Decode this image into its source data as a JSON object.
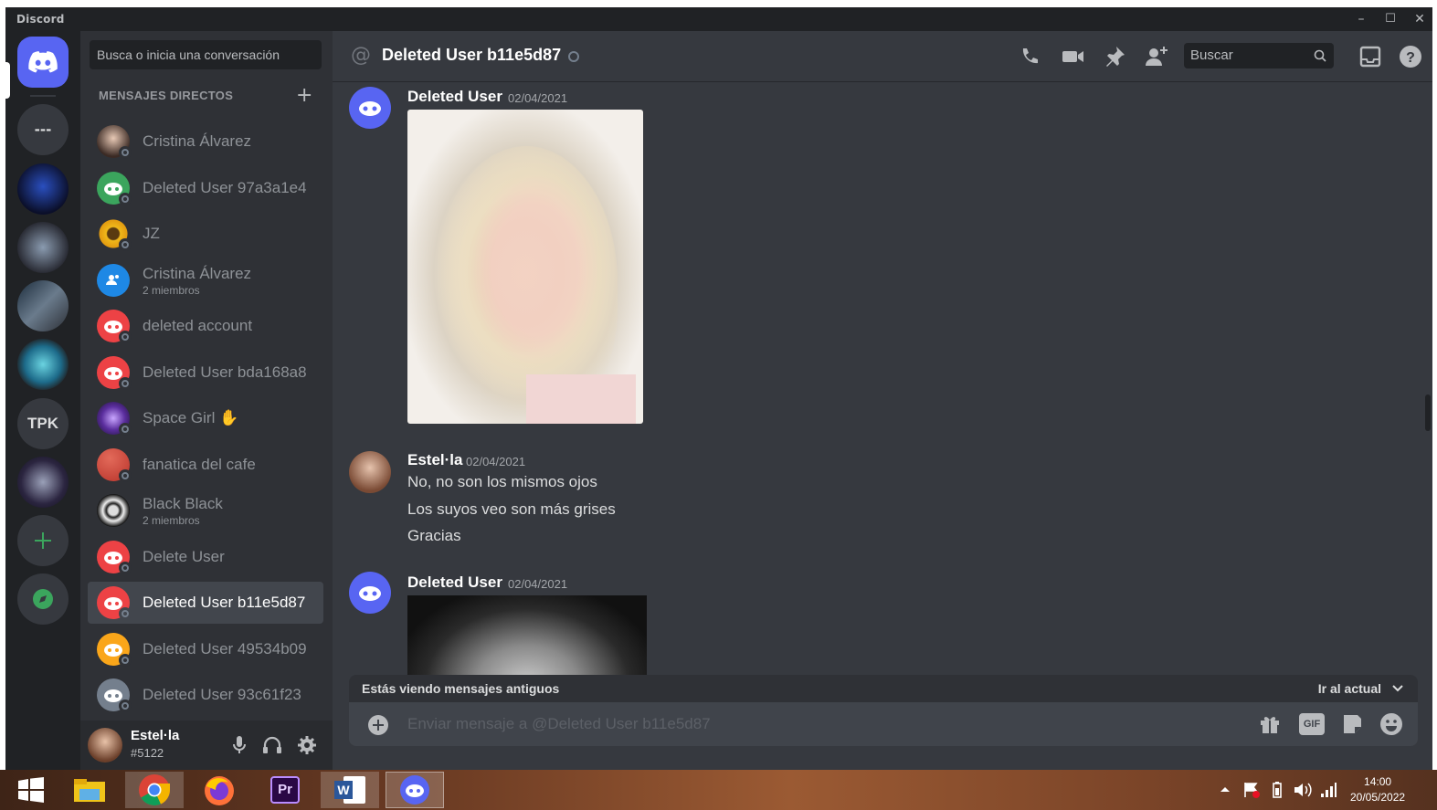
{
  "window": {
    "app_name": "Discord",
    "minimize": "–",
    "maximize": "☐",
    "close": "✕"
  },
  "colors": {
    "blurple": "#5865f2",
    "bg_chat": "#36393f",
    "bg_sidebar": "#2f3136",
    "bg_rail": "#202225",
    "green": "#3ba55d",
    "red": "#ed4245",
    "yellow": "#faa61a"
  },
  "servers": {
    "home_icon": "discord-logo-icon",
    "items": [
      "---",
      "TPK"
    ],
    "add_icon": "plus-icon",
    "explore_icon": "compass-icon"
  },
  "dms": {
    "search_placeholder": "Busca o inicia una conversación",
    "header": "MENSAJES DIRECTOS",
    "add_icon": "+",
    "items": [
      {
        "name": "Cristina Álvarez",
        "sub": ""
      },
      {
        "name": "Deleted User 97a3a1e4",
        "sub": ""
      },
      {
        "name": "JZ",
        "sub": ""
      },
      {
        "name": "Cristina Álvarez",
        "sub": "2 miembros"
      },
      {
        "name": "deleted account",
        "sub": ""
      },
      {
        "name": "Deleted User bda168a8",
        "sub": ""
      },
      {
        "name": "Space Girl",
        "sub": ""
      },
      {
        "name": "fanatica del cafe",
        "sub": ""
      },
      {
        "name": "Black Black",
        "sub": "2 miembros"
      },
      {
        "name": "Delete User",
        "sub": ""
      },
      {
        "name": "Deleted User b11e5d87",
        "sub": ""
      },
      {
        "name": "Deleted User 49534b09",
        "sub": ""
      },
      {
        "name": "Deleted User 93c61f23",
        "sub": ""
      }
    ],
    "selected_index": 10
  },
  "user": {
    "name": "Estel·la",
    "tag": "#5122"
  },
  "chat": {
    "title": "Deleted User b11e5d87",
    "search_placeholder": "Buscar",
    "messages": [
      {
        "author": "Deleted User",
        "time": "02/04/2021"
      },
      {
        "author": "Estel·la",
        "time": "02/04/2021",
        "lines": [
          "No, no son los mismos ojos",
          "Los suyos veo son más grises",
          "Gracias"
        ]
      },
      {
        "author": "Deleted User",
        "time": "02/04/2021"
      }
    ],
    "old_messages_text": "Estás viendo mensajes antiguos",
    "jump_present": "Ir al actual",
    "compose_placeholder": "Enviar mensaje a @Deleted User b11e5d87",
    "gif_label": "GIF"
  },
  "taskbar": {
    "time": "14:00",
    "date": "20/05/2022",
    "apps": [
      "windows-start",
      "file-explorer",
      "chrome",
      "firefox",
      "premiere-pro",
      "word",
      "discord"
    ],
    "premiere_label": "Pr",
    "word_label": "W"
  }
}
